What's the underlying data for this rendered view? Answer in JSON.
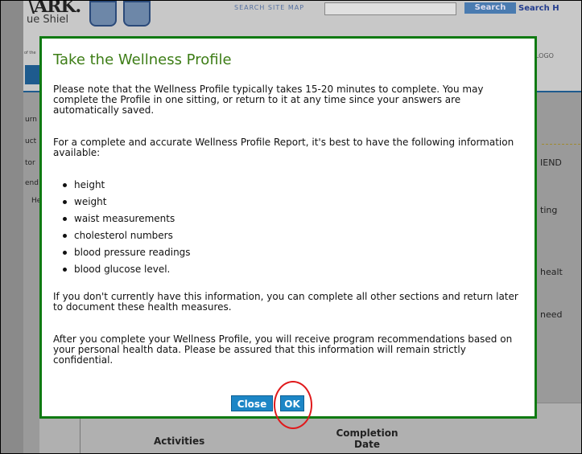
{
  "background": {
    "logo_text": "\\ARK.",
    "logo_sub": "ue Shiel",
    "logo_tiny": "of the",
    "search_label": "SEARCH SITE MAP",
    "search_input_value": "",
    "search_button": "Search",
    "search_link": "Search H",
    "logo_right": "LOGO",
    "side_items": [
      "urn",
      "uct",
      "tor",
      "end",
      "He"
    ],
    "right_items": [
      "IEND",
      "ting",
      "healt",
      "need"
    ],
    "table": {
      "columns": [
        "Activities",
        "Completion Date"
      ]
    }
  },
  "modal": {
    "title": "Take the Wellness Profile",
    "paragraph_1": "Please note that the Wellness Profile typically takes 15-20 minutes to complete. You may complete the Profile in one sitting, or return to it at any time since your answers are automatically saved.",
    "paragraph_2": "For a complete and accurate Wellness Profile Report, it's best to have the following information available:",
    "bullets": [
      "height",
      "weight",
      "waist measurements",
      "cholesterol numbers",
      "blood pressure readings",
      "blood glucose level."
    ],
    "paragraph_3": "If you don't currently have this information, you can complete all other sections and return later to document these health measures.",
    "paragraph_4": "After you complete your Wellness Profile, you will receive program recommendations based on your personal health data. Please be assured that this information will remain strictly confidential.",
    "close_label": "Close",
    "ok_label": "OK"
  },
  "colors": {
    "modal_border": "#0f7a12",
    "title": "#3d7d16",
    "button": "#1d86c6",
    "highlight": "#e0191b"
  }
}
